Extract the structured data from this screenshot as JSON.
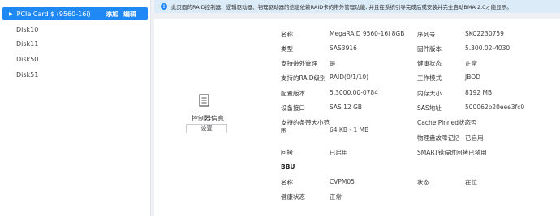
{
  "sidebar": {
    "selected": {
      "label": "PCIe Card $ (9560-16i)",
      "add": "添加",
      "edit": "编辑"
    },
    "disks": [
      "Disk10",
      "Disk11",
      "Disk50",
      "Disk51"
    ]
  },
  "banner": {
    "text": "此页面的RAID控制器、逻辑驱动器、物理驱动器的信息依赖RAID卡的带外管理功能, 并且在系统引导完成后或安装并完全启动BMA 2.0才能显示。"
  },
  "controller": {
    "label": "控制器信息",
    "settings": "设置"
  },
  "info": {
    "name_k": "名称",
    "name_v": "MegaRAID 9560-16i 8GB",
    "serial_k": "序列号",
    "serial_v": "SKC2230759",
    "type_k": "类型",
    "type_v": "SAS3916",
    "firmware_k": "固件版本",
    "firmware_v": "5.300.02-4030",
    "oob_k": "支持带外管理",
    "oob_v": "是",
    "health_k": "健康状态",
    "health_v": "正常",
    "raid_k": "支持的RAID级别",
    "raid_v": "RAID(0/1/10)",
    "mode_k": "工作模式",
    "mode_v": "JBOD",
    "cfgver_k": "配置版本",
    "cfgver_v": "5.3000.00-0784",
    "mem_k": "内存大小",
    "mem_v": "8192 MB",
    "iface_k": "设备接口",
    "iface_v": "SAS 12 GB",
    "sasaddr_k": "SAS地址",
    "sasaddr_v": "500062b20eee3fc0",
    "strip_k1": "支持的条带大小范",
    "strip_k2": "围",
    "strip_v": "64 KB - 1 MB",
    "cache_k": "Cache Pinned状态否",
    "pdlog_k": "物理盘故障记忆",
    "pdlog_v": "已启用",
    "copyback_k": "回拷",
    "copyback_v": "已启用",
    "smart_k": "SMART错误时回拷已禁用"
  },
  "bbu": {
    "title": "BBU",
    "name_k": "名称",
    "name_v": "CVPM05",
    "state_k": "状态",
    "state_v": "在位",
    "health_k": "健康状态",
    "health_v": "正常"
  },
  "colors": {
    "accent": "#1e88f5",
    "banner_bg": "#dcebf8",
    "page_bg": "#eef0f3"
  }
}
